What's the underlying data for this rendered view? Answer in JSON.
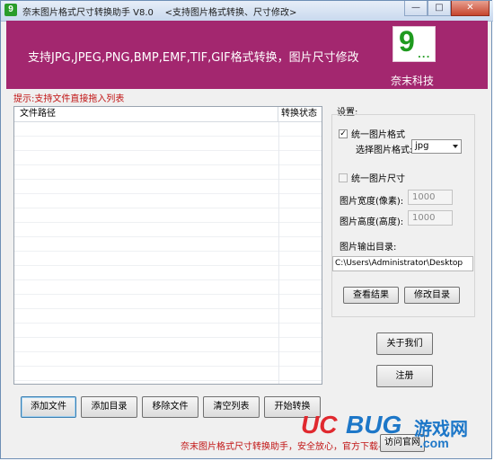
{
  "window": {
    "title": "奈末图片格式尺寸转换助手 V8.0    <支持图片格式转换、尺寸修改>",
    "app_icon": "9"
  },
  "banner": {
    "text": "支持JPG,JPEG,PNG,BMP,EMF,TIF,GIF格式转换，图片尺寸修改",
    "logo_digit": "9",
    "logo_dots": "...",
    "logo_caption": "奈末科技",
    "background_color": "#a3276f"
  },
  "hint": "提示:支持文件直接拖入列表",
  "file_list": {
    "columns": [
      "文件路径",
      "转换状态"
    ],
    "rows": []
  },
  "buttons": {
    "add_file": "添加文件",
    "add_folder": "添加目录",
    "remove_file": "移除文件",
    "clear_list": "清空列表",
    "start_convert": "开始转换",
    "about": "关于我们",
    "register": "注册",
    "view_result": "查看结果",
    "change_dir": "修改目录",
    "visit_site": "访问官网"
  },
  "settings": {
    "title": "设置:",
    "unify_format": {
      "label": "统一图片格式",
      "checked": true,
      "mark": "✓"
    },
    "format_label": "选择图片格式:",
    "format_value": "jpg",
    "unify_size": {
      "label": "统一图片尺寸",
      "checked": false
    },
    "width_label": "图片宽度(像素):",
    "width_value": "1000",
    "height_label": "图片高度(高度):",
    "height_value": "1000",
    "output_label": "图片输出目录:",
    "output_path": "C:\\Users\\Administrator\\Desktop"
  },
  "footer_note": "奈末图片格式尺寸转换助手，安全放心，官方下载-->",
  "watermark": {
    "uc": "UC",
    "bug": "BUG",
    "game": "游戏网",
    "com": ".com"
  }
}
